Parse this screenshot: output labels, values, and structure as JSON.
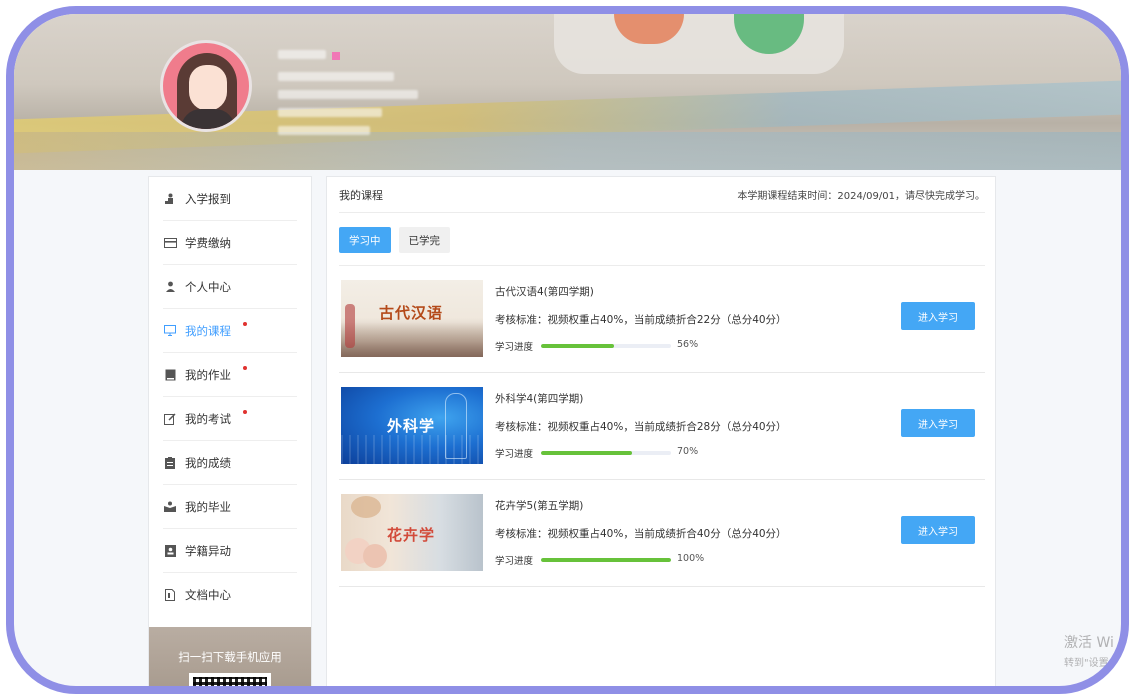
{
  "sidebar": {
    "items": [
      {
        "label": "入学报到",
        "icon": "person-stand-icon"
      },
      {
        "label": "学费缴纳",
        "icon": "card-icon"
      },
      {
        "label": "个人中心",
        "icon": "user-icon"
      },
      {
        "label": "我的课程",
        "icon": "monitor-icon"
      },
      {
        "label": "我的作业",
        "icon": "book-icon"
      },
      {
        "label": "我的考试",
        "icon": "edit-icon"
      },
      {
        "label": "我的成绩",
        "icon": "clipboard-icon"
      },
      {
        "label": "我的毕业",
        "icon": "graduation-icon"
      },
      {
        "label": "学籍异动",
        "icon": "id-card-icon"
      },
      {
        "label": "文档中心",
        "icon": "document-icon"
      }
    ],
    "qr_text": "扫一扫下载手机应用"
  },
  "main": {
    "title": "我的课程",
    "notice": "本学期课程结束时间：2024/09/01，请尽快完成学习。",
    "tabs": [
      {
        "label": "学习中"
      },
      {
        "label": "已学完"
      }
    ],
    "progress_label": "学习进度",
    "enter_label": "进入学习",
    "courses": [
      {
        "name": "古代汉语4(第四学期)",
        "thumb_title": "古代汉语",
        "standard": "考核标准：视频权重占40%，当前成绩折合22分（总分40分）",
        "progress": 56,
        "progress_text": "56%"
      },
      {
        "name": "外科学4(第四学期)",
        "thumb_title": "外科学",
        "standard": "考核标准：视频权重占40%，当前成绩折合28分（总分40分）",
        "progress": 70,
        "progress_text": "70%"
      },
      {
        "name": "花卉学5(第五学期)",
        "thumb_title": "花卉学",
        "standard": "考核标准：视频权重占40%，当前成绩折合40分（总分40分）",
        "progress": 100,
        "progress_text": "100%"
      }
    ]
  },
  "watermark": {
    "line1": "激活 Wi",
    "line2": "转到\"设置"
  },
  "colors": {
    "accent": "#44a7f5",
    "progress": "#67c23a",
    "frame": "#8f8fe6",
    "badge": "#e0322f"
  }
}
